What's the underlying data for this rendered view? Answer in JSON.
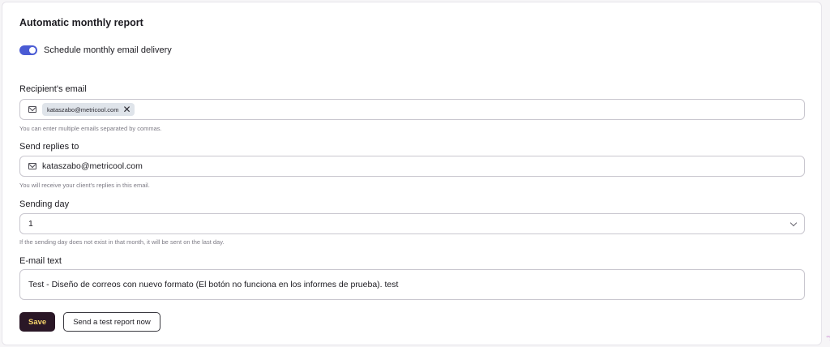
{
  "section": {
    "title": "Automatic monthly report"
  },
  "schedule": {
    "label": "Schedule monthly email delivery",
    "enabled": true
  },
  "recipient": {
    "label": "Recipient's email",
    "chip": "kataszabo@metricool.com",
    "help": "You can enter multiple emails separated by commas."
  },
  "replies": {
    "label": "Send replies to",
    "value": "kataszabo@metricool.com",
    "help": "You will receive your client's replies in this email."
  },
  "sending_day": {
    "label": "Sending day",
    "value": "1",
    "help": "If the sending day does not exist in that month, it will be sent on the last day."
  },
  "email_text": {
    "label": "E-mail text",
    "value": "Test - Diseño de correos con nuevo formato (El botón no funciona en los informes de prueba). test"
  },
  "buttons": {
    "save": "Save",
    "test": "Send a test report now"
  },
  "colors": {
    "toggle": "#4a5bd4",
    "primary_bg": "#2a1726",
    "primary_text": "#f5d36b"
  },
  "icons": {
    "mail": "mail-icon",
    "chip_close": "close-icon",
    "select": "chevron-down-icon"
  }
}
